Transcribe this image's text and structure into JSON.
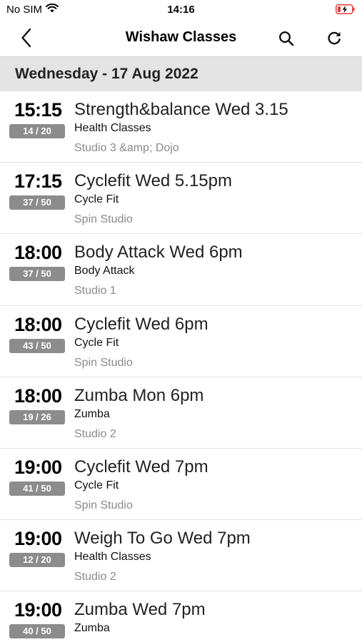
{
  "status_bar": {
    "carrier": "No SIM",
    "time": "14:16",
    "wifi_icon": "wifi-icon",
    "battery_icon": "battery-charging-icon"
  },
  "nav": {
    "title": "Wishaw Classes",
    "back_icon": "chevron-left-icon",
    "search_icon": "search-icon",
    "refresh_icon": "refresh-icon"
  },
  "date_header": "Wednesday - 17 Aug 2022",
  "colors": {
    "capacity_badge": "#8c8c8c",
    "date_header_bg": "#e4e4e4",
    "battery_charging": "#e63b3b"
  },
  "classes": [
    {
      "time": "15:15",
      "capacity": "14 / 20",
      "name": "Strength&balance Wed 3.15",
      "category": "Health Classes",
      "location": "Studio 3 &amp; Dojo"
    },
    {
      "time": "17:15",
      "capacity": "37 / 50",
      "name": "Cyclefit Wed 5.15pm",
      "category": "Cycle Fit",
      "location": "Spin Studio"
    },
    {
      "time": "18:00",
      "capacity": "37 / 50",
      "name": "Body Attack Wed 6pm",
      "category": "Body Attack",
      "location": "Studio 1"
    },
    {
      "time": "18:00",
      "capacity": "43 / 50",
      "name": "Cyclefit Wed 6pm",
      "category": "Cycle Fit",
      "location": "Spin Studio"
    },
    {
      "time": "18:00",
      "capacity": "19 / 26",
      "name": "Zumba Mon 6pm",
      "category": "Zumba",
      "location": "Studio 2"
    },
    {
      "time": "19:00",
      "capacity": "41 / 50",
      "name": "Cyclefit Wed 7pm",
      "category": "Cycle Fit",
      "location": "Spin Studio"
    },
    {
      "time": "19:00",
      "capacity": "12 / 20",
      "name": "Weigh To Go Wed 7pm",
      "category": "Health Classes",
      "location": "Studio 2"
    },
    {
      "time": "19:00",
      "capacity": "40 / 50",
      "name": "Zumba Wed 7pm",
      "category": "Zumba",
      "location": ""
    }
  ]
}
